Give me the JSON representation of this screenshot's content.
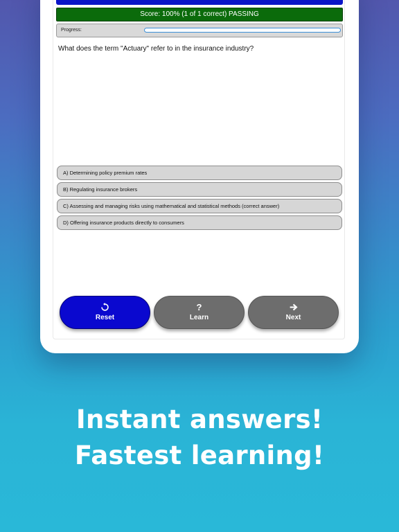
{
  "quiz": {
    "score_text": "Score: 100% (1 of 1 correct) PASSING",
    "progress_label": "Progress:",
    "progress_fraction": 0.0,
    "question": "What does the term \"Actuary\" refer to in the insurance industry?",
    "answers": [
      "A)  Determining policy premium rates",
      "B)  Regulating insurance brokers",
      "C)  Assessing and managing risks using mathematical and statistical methods (correct answer)",
      "D)  Offering insurance products directly to consumers"
    ]
  },
  "buttons": {
    "reset": {
      "label": "Reset",
      "icon": "reset-icon"
    },
    "learn": {
      "label": "Learn",
      "icon": "question-icon"
    },
    "next": {
      "label": "Next",
      "icon": "arrow-right-icon"
    }
  },
  "tagline": {
    "line1": "Instant answers!",
    "line2": "Fastest learning!"
  },
  "colors": {
    "header": "#0a14c8",
    "score_bar": "#0b6b0b",
    "reset_button": "#0a08cf",
    "gray_button": "#6d6d6d"
  }
}
